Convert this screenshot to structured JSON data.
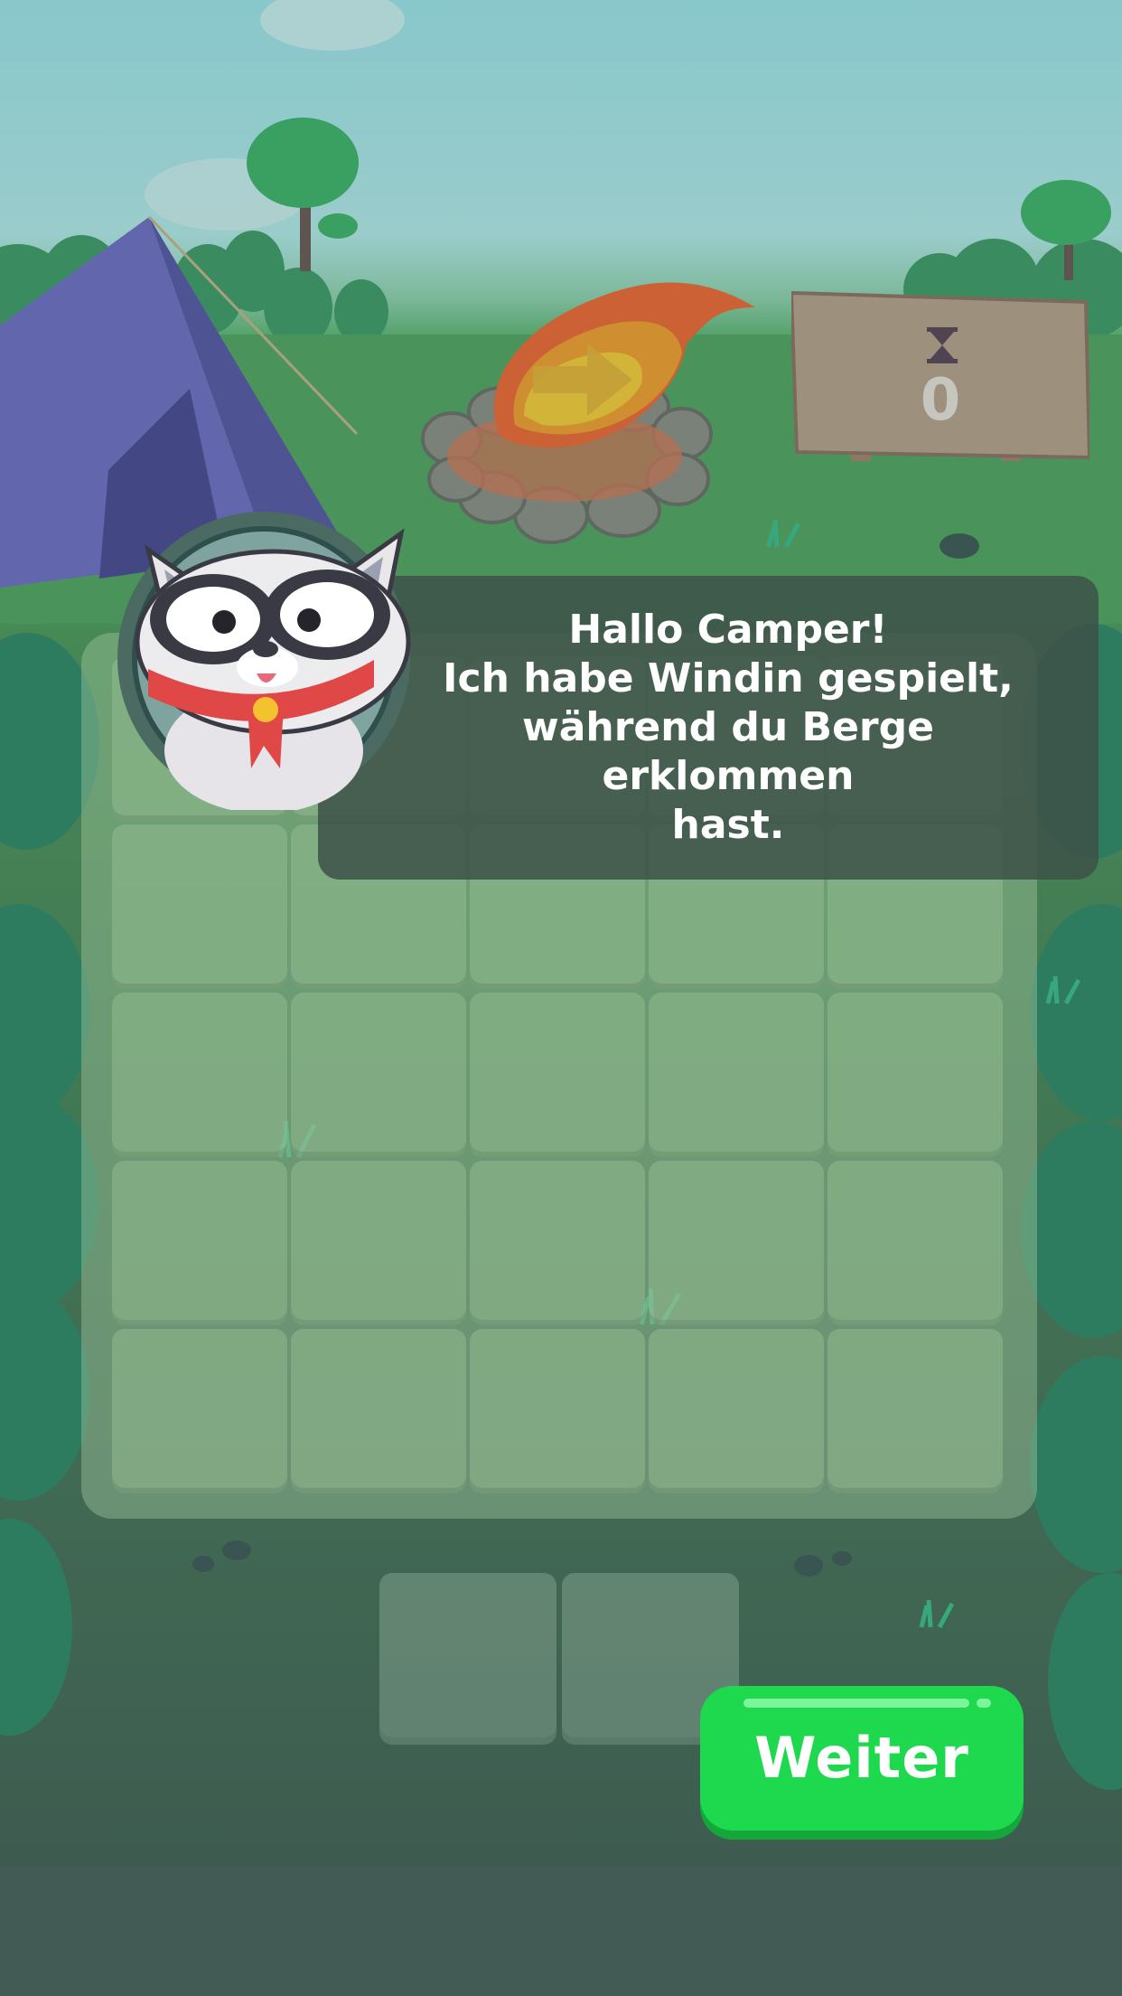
{
  "dialog": {
    "text": "Hallo Camper!\nIch habe Windin gespielt,\nwährend du Berge erklommen\nhast."
  },
  "score": {
    "value": "0",
    "icon": "hourglass-icon"
  },
  "buttons": {
    "continue_label": "Weiter"
  },
  "colors": {
    "button": "#1ed84e",
    "dialog_bg": "#3e5248",
    "sign": "#b8a38c",
    "tent": "#6f70c6"
  }
}
